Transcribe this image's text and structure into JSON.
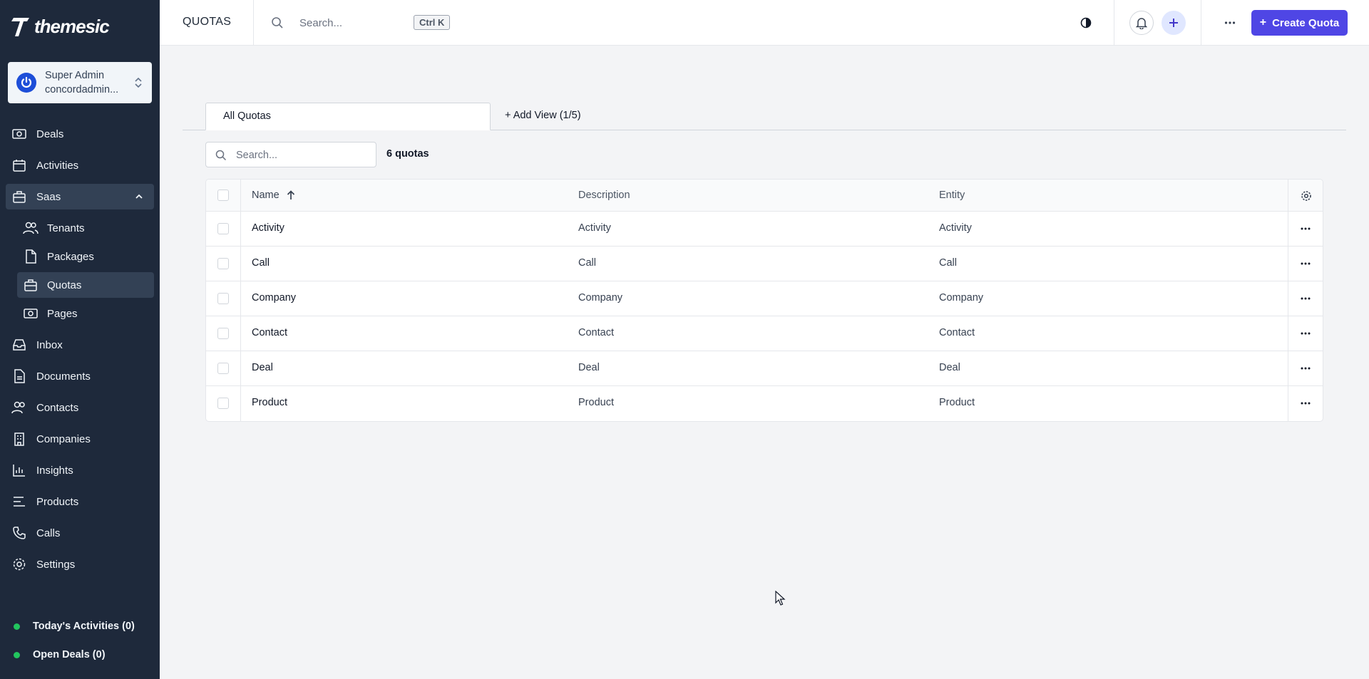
{
  "app": {
    "logo_text": "themesic"
  },
  "user": {
    "name": "Super Admin",
    "email": "concordadmin..."
  },
  "sidebar": {
    "items": [
      {
        "label": "Deals",
        "icon": "money-icon"
      },
      {
        "label": "Activities",
        "icon": "calendar-icon"
      },
      {
        "label": "Saas",
        "icon": "briefcase-icon",
        "expanded": true
      },
      {
        "label": "Inbox",
        "icon": "inbox-icon"
      },
      {
        "label": "Documents",
        "icon": "document-icon"
      },
      {
        "label": "Contacts",
        "icon": "users-icon"
      },
      {
        "label": "Companies",
        "icon": "building-icon"
      },
      {
        "label": "Insights",
        "icon": "chart-icon"
      },
      {
        "label": "Products",
        "icon": "list-icon"
      },
      {
        "label": "Calls",
        "icon": "phone-icon"
      },
      {
        "label": "Settings",
        "icon": "gear-icon"
      }
    ],
    "saas_children": [
      {
        "label": "Tenants",
        "icon": "users-icon"
      },
      {
        "label": "Packages",
        "icon": "document-icon"
      },
      {
        "label": "Quotas",
        "icon": "briefcase-icon",
        "active": true
      },
      {
        "label": "Pages",
        "icon": "money-icon"
      }
    ],
    "footer": [
      {
        "label": "Today's Activities (0)"
      },
      {
        "label": "Open Deals (0)"
      }
    ]
  },
  "header": {
    "title": "QUOTAS",
    "search_placeholder": "Search...",
    "shortcut": "Ctrl K",
    "create_label": "Create Quota"
  },
  "views": {
    "active_tab": "All Quotas",
    "add_view": "+ Add View (1/5)"
  },
  "table": {
    "search_placeholder": "Search...",
    "count_label": "6 quotas",
    "columns": [
      "Name",
      "Description",
      "Entity"
    ],
    "sort": {
      "column": "Name",
      "direction": "asc"
    },
    "rows": [
      [
        "Activity",
        "Activity",
        "Activity"
      ],
      [
        "Call",
        "Call",
        "Call"
      ],
      [
        "Company",
        "Company",
        "Company"
      ],
      [
        "Contact",
        "Contact",
        "Contact"
      ],
      [
        "Deal",
        "Deal",
        "Deal"
      ],
      [
        "Product",
        "Product",
        "Product"
      ]
    ]
  },
  "colors": {
    "sidebar_bg": "#1e293b",
    "sidebar_active": "#334155",
    "primary": "#4f46e5",
    "status_green": "#22c55e"
  }
}
